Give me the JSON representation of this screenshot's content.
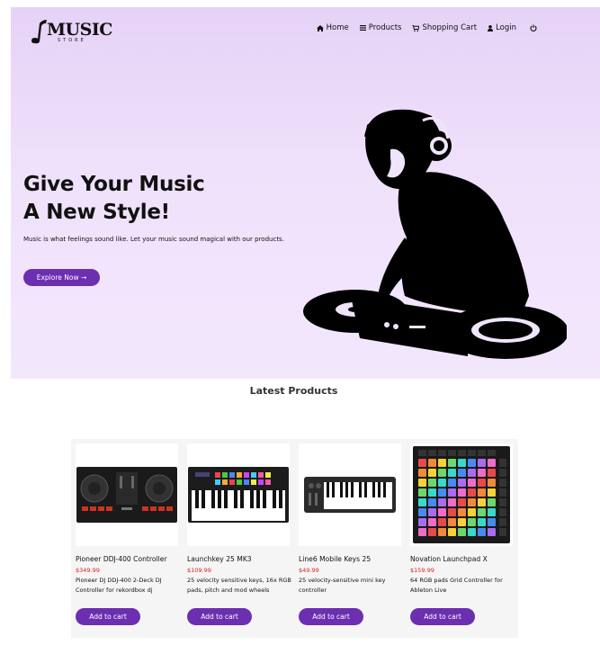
{
  "brand": {
    "logo_text": "MUSIC",
    "logo_subtext": "STORE"
  },
  "nav": [
    {
      "label": "Home",
      "icon": "home-icon"
    },
    {
      "label": "Products",
      "icon": "list-icon"
    },
    {
      "label": "Shopping Cart",
      "icon": "cart-icon"
    },
    {
      "label": "Login",
      "icon": "user-icon"
    },
    {
      "label": "",
      "icon": "power-icon"
    }
  ],
  "hero": {
    "title_line1": "Give Your Music",
    "title_line2": "A New Style!",
    "description": "Music is what feelings sound like. Let your music sound magical with our products.",
    "button_label": "Explore Now →"
  },
  "latest": {
    "title": "Latest Products",
    "add_label": "Add to cart",
    "products": [
      {
        "name": "Pioneer DDJ-400 Controller",
        "price": "$349.99",
        "description": "Pioneer DJ DDJ-400 2-Deck DJ Controller for rekordbox dj"
      },
      {
        "name": "Launchkey 25 MK3",
        "price": "$109.99",
        "description": "25 velocity sensitive keys, 16x RGB pads, pitch and mod wheels"
      },
      {
        "name": "Line6 Mobile Keys 25",
        "price": "$49.99",
        "description": "25 velocity-sensitive mini key controller"
      },
      {
        "name": "Novation Launchpad X",
        "price": "$159.99",
        "description": "64 RGB pads Grid Controller for Ableton Live"
      }
    ]
  },
  "colors": {
    "accent": "#6b2fb0",
    "price": "#e0201c",
    "hero_bg": "#ecdcf9"
  }
}
